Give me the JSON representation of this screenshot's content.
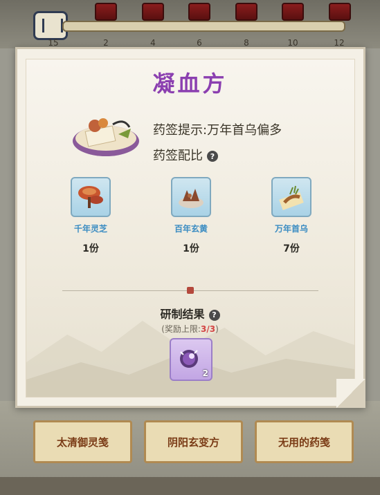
{
  "progress": {
    "ticks": [
      "15",
      "2",
      "4",
      "6",
      "8",
      "10",
      "12"
    ]
  },
  "recipe": {
    "title": "凝血方",
    "hint": "药签提示:万年首乌偏多",
    "ratio_label": "药签配比",
    "help_glyph": "?",
    "ingredients": [
      {
        "name": "千年灵芝",
        "qty": "1份",
        "icon": "lingzhi-mushroom-icon"
      },
      {
        "name": "百年玄黄",
        "qty": "1份",
        "icon": "xuanhuang-herb-icon"
      },
      {
        "name": "万年首乌",
        "qty": "7份",
        "icon": "shouwu-root-icon"
      }
    ],
    "result_title": "研制结果",
    "reward_limit_prefix": "(奖励上限:",
    "reward_limit_value": "3/3",
    "reward_limit_suffix": ")",
    "result_count": "2"
  },
  "bottom_buttons": [
    {
      "label": "太清御灵笺"
    },
    {
      "label": "阴阳玄变方"
    },
    {
      "label": "无用的药笺"
    }
  ],
  "colors": {
    "title": "#8b3fb0",
    "ingredient_name": "#3a8cc2",
    "reward_value": "#d34343"
  }
}
